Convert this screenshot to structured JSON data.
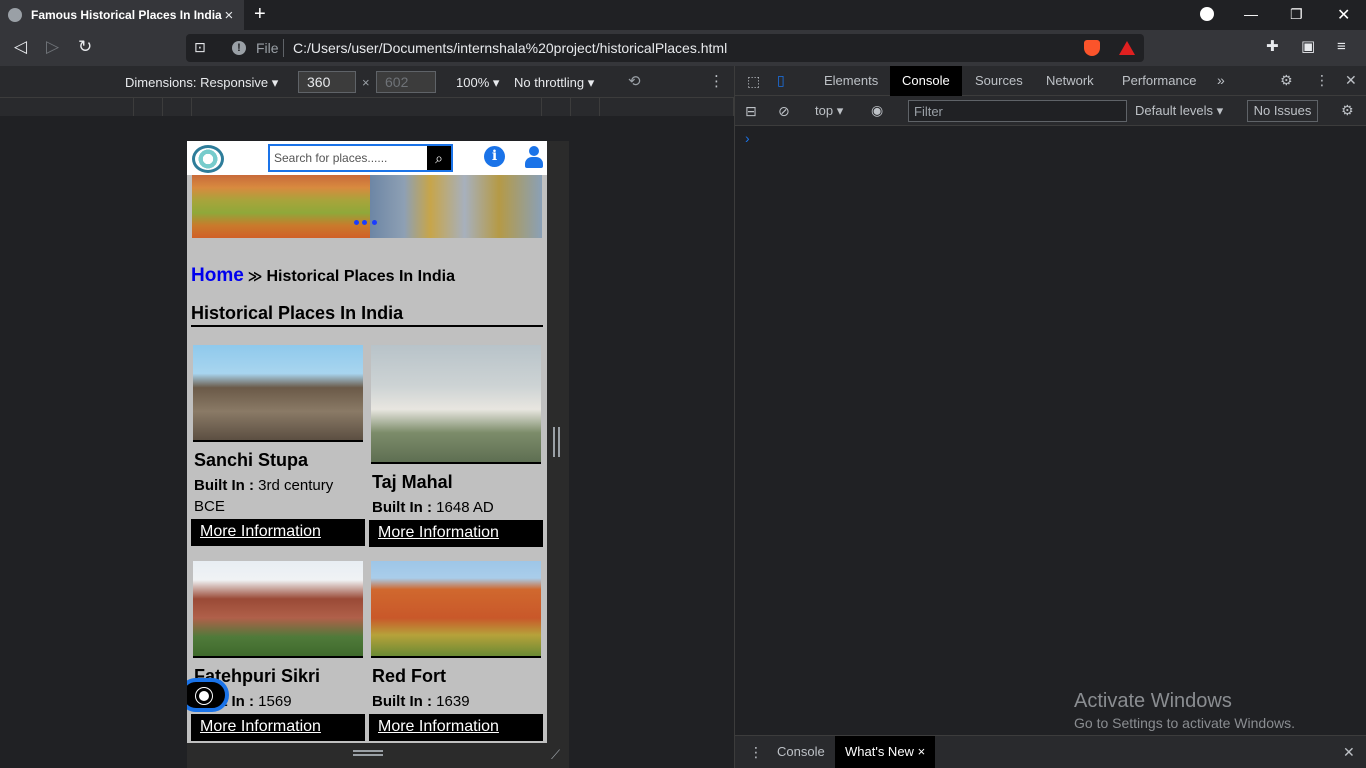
{
  "browser": {
    "tab_title": "Famous Historical Places In India",
    "tab_close": "×",
    "new_tab": "+",
    "url_scheme_label": "File",
    "url": "C:/Users/user/Documents/internshala%20project/historicalPlaces.html"
  },
  "device_toolbar": {
    "dimensions_label": "Dimensions: Responsive",
    "width": "360",
    "height": "602",
    "times": "×",
    "zoom": "100%",
    "throttling": "No throttling"
  },
  "page": {
    "search_placeholder": "Search for places......",
    "breadcrumb": {
      "home": "Home",
      "separator": "≫",
      "current": "Historical Places In India"
    },
    "title": "Historical Places In India",
    "built_label": "Built In :",
    "more_label": "More Information",
    "places": [
      {
        "name": "Sanchi Stupa",
        "built": "3rd century BCE"
      },
      {
        "name": "Taj Mahal",
        "built": "1648 AD"
      },
      {
        "name": "Fatehpuri Sikri",
        "built": "1569"
      },
      {
        "name": "Red Fort",
        "built": "1639"
      }
    ]
  },
  "devtools": {
    "tabs": [
      "Elements",
      "Console",
      "Sources",
      "Network",
      "Performance"
    ],
    "active_tab": "Console",
    "context": "top",
    "filter_placeholder": "Filter",
    "levels": "Default levels",
    "issues": "No Issues",
    "prompt": "›",
    "drawer_tabs": [
      "Console",
      "What's New"
    ],
    "drawer_close": "×"
  },
  "watermark": {
    "line1": "Activate Windows",
    "line2": "Go to Settings to activate Windows."
  }
}
